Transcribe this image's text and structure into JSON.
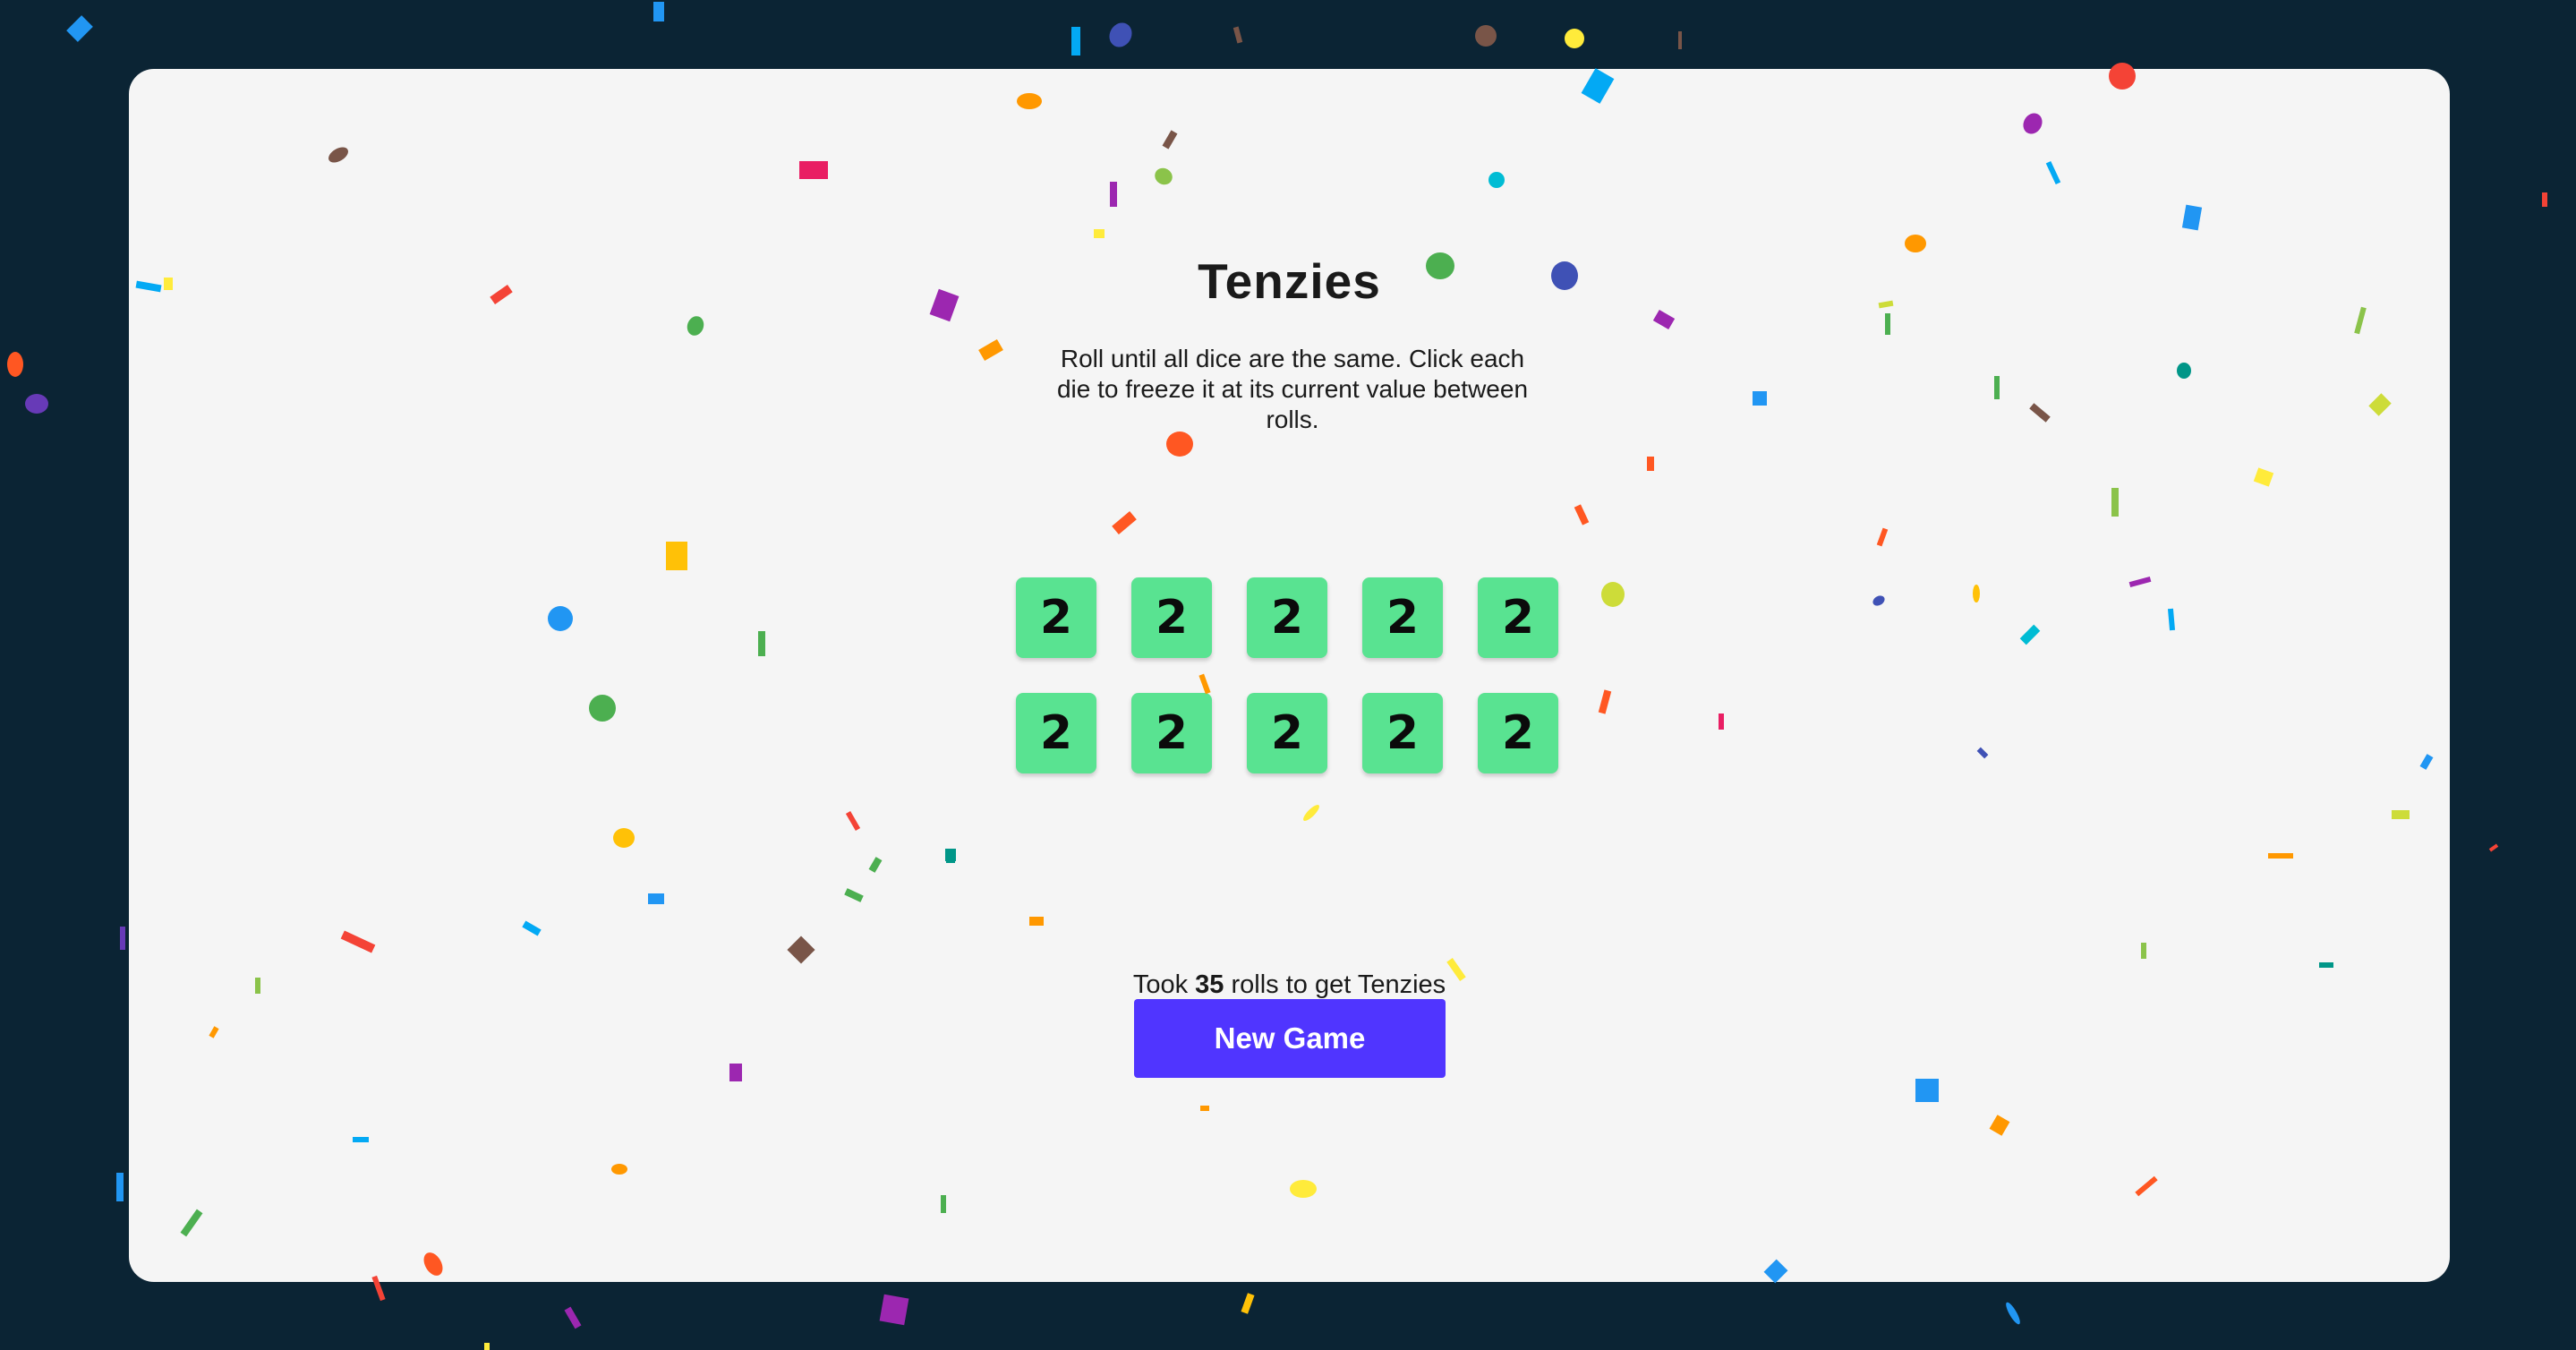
{
  "game": {
    "title": "Tenzies",
    "instructions": "Roll until all dice are the same. Click each die to freeze it at its current value between rolls.",
    "dice": [
      2,
      2,
      2,
      2,
      2,
      2,
      2,
      2,
      2,
      2
    ],
    "rolls_prefix": "Took",
    "rolls_count": "35",
    "rolls_suffix": "rolls to get Tenzies",
    "new_game_label": "New Game"
  },
  "colors": {
    "background": "#0b2434",
    "card": "#f5f5f5",
    "die_held": "#59e391",
    "button": "#5035ff"
  },
  "confetti_palette": [
    "#f44336",
    "#e91e63",
    "#9c27b0",
    "#673ab7",
    "#3f51b5",
    "#2196f3",
    "#03a9f4",
    "#00bcd4",
    "#009688",
    "#4caf50",
    "#8bc34a",
    "#cddc39",
    "#ffeb3b",
    "#ffc107",
    "#ff9800",
    "#ff5722",
    "#795548"
  ]
}
